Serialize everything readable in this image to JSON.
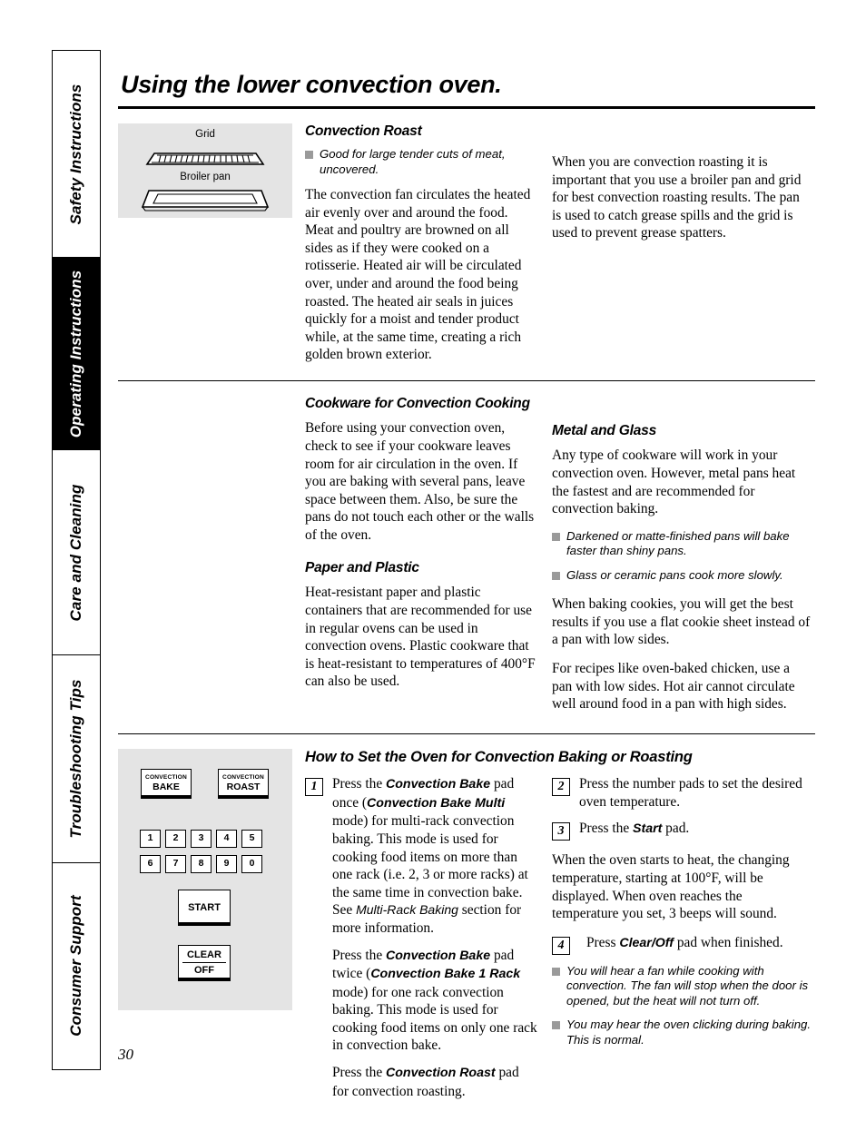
{
  "sidebar": {
    "tabs": [
      {
        "label": "Safety Instructions",
        "active": false
      },
      {
        "label": "Operating Instructions",
        "active": true
      },
      {
        "label": "Care and Cleaning",
        "active": false
      },
      {
        "label": "Troubleshooting Tips",
        "active": false
      },
      {
        "label": "Consumer Support",
        "active": false
      }
    ]
  },
  "page": {
    "title": "Using the lower convection oven.",
    "number": "30"
  },
  "pan_art": {
    "grid_label": "Grid",
    "pan_label": "Broiler pan"
  },
  "convection_roast": {
    "heading": "Convection Roast",
    "note": "Good for large tender cuts of meat, uncovered.",
    "body": "The convection fan circulates the heated air evenly over and around the food. Meat and poultry are browned on all sides as if they were cooked on a rotisserie. Heated air will be circulated over, under and around the food being roasted. The heated air seals in juices quickly for a moist and tender product while, at the same time, creating a rich golden brown exterior.",
    "right_body": "When you are convection roasting it is important that you use a broiler pan and grid for best convection roasting results. The pan is used to catch grease spills and the grid is used to prevent grease spatters."
  },
  "cookware": {
    "heading": "Cookware for Convection Cooking",
    "body": "Before using your convection oven, check to see if your cookware leaves room for air circulation in the oven. If you are baking with several pans, leave space between them. Also, be sure the pans do not touch each other or the walls of the oven.",
    "paper_heading": "Paper and Plastic",
    "paper_body": "Heat-resistant paper and plastic containers that are recommended for use in regular ovens can be used in convection ovens. Plastic cookware that is heat-resistant to temperatures of 400°F can also be used."
  },
  "metal_glass": {
    "heading": "Metal and Glass",
    "body": "Any type of cookware will work in your convection oven. However, metal pans heat the fastest and are recommended for convection baking.",
    "notes": [
      "Darkened or matte-finished pans will bake faster than shiny pans.",
      "Glass or ceramic pans cook more slowly."
    ],
    "body2": "When baking cookies, you will get the best results if you use a flat cookie sheet instead of a pan with low sides.",
    "body3": "For recipes like oven-baked chicken, use a pan with low sides. Hot air cannot circulate well around food in a pan with high sides."
  },
  "how_to": {
    "heading": "How to Set the Oven for Convection Baking or Roasting",
    "steps": {
      "one": {
        "num": "1",
        "p1_pre": "Press the ",
        "p1_pad1": "Convection Bake",
        "p1_mid": " pad once (",
        "p1_pad2": "Convection Bake Multi",
        "p1_post": " mode) for multi-rack convection baking. This mode is used for cooking food items on more than one rack (i.e. 2, 3 or more racks) at the same time in convection bake. See ",
        "p1_em": "Multi-Rack Baking",
        "p1_end": " section for more information.",
        "p2_pre": "Press the ",
        "p2_pad1": "Convection Bake",
        "p2_mid": " pad twice (",
        "p2_pad2": "Convection Bake 1 Rack",
        "p2_post": " mode) for one rack convection baking. This mode is used for cooking food items on only one rack in convection bake.",
        "p3_pre": "Press the ",
        "p3_pad1": "Convection Roast",
        "p3_post": " pad for convection roasting."
      },
      "two": {
        "num": "2",
        "text": "Press the number pads to set the desired oven temperature."
      },
      "three": {
        "num": "3",
        "pre": "Press the ",
        "pad": "Start",
        "post": " pad."
      },
      "four": {
        "num": "4",
        "pre": "Press ",
        "pad": "Clear/Off",
        "post": " pad when finished."
      }
    },
    "heat_note": "When the oven starts to heat, the changing temperature, starting at 100°F, will be displayed. When oven reaches the temperature you set, 3 beeps will sound.",
    "notes": [
      "You will hear a fan while cooking with convection. The fan will stop when the door is opened, but the heat will not turn off.",
      "You may hear the oven clicking during baking. This is normal."
    ]
  },
  "control_panel": {
    "convection_bake": {
      "line1": "CONVECTION",
      "line2": "BAKE"
    },
    "convection_roast": {
      "line1": "CONVECTION",
      "line2": "ROAST"
    },
    "number_keys": [
      "1",
      "2",
      "3",
      "4",
      "5",
      "6",
      "7",
      "8",
      "9",
      "0"
    ],
    "start": "START",
    "clear": "CLEAR",
    "off": "OFF"
  },
  "colors": {
    "art_background": "#e4e4e4",
    "bullet_square": "#9a9a9a",
    "ink": "#000000"
  }
}
